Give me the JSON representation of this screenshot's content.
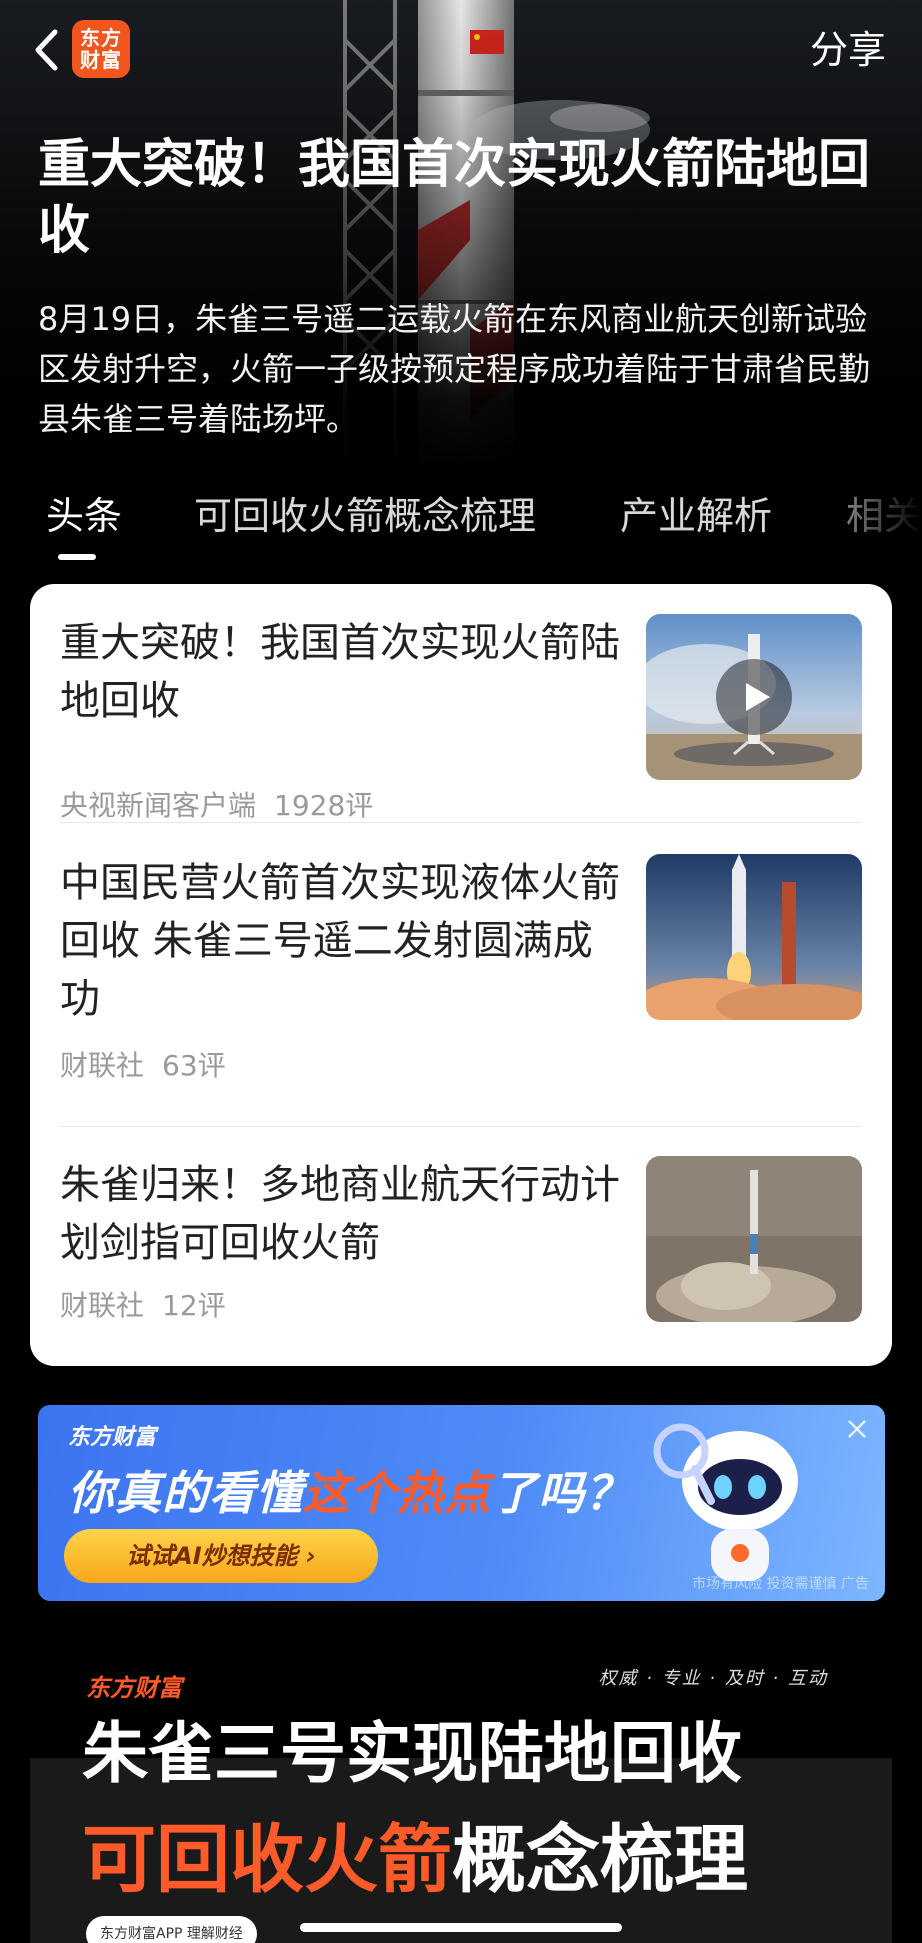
{
  "header": {
    "back_icon": "chevron-left-icon",
    "logo_text": "东方财富",
    "share_label": "分享"
  },
  "hero": {
    "title": "重大突破！我国首次实现火箭陆地回收",
    "summary": "8月19日，朱雀三号遥二运载火箭在东风商业航天创新试验区发射升空，火箭一子级按预定程序成功着陆于甘肃省民勤县朱雀三号着陆场坪。"
  },
  "tabs": [
    {
      "label": "头条",
      "active": true
    },
    {
      "label": "可回收火箭概念梳理",
      "active": false
    },
    {
      "label": "产业解析",
      "active": false
    },
    {
      "label": "相关",
      "active": false
    }
  ],
  "news": [
    {
      "title": "重大突破！我国首次实现火箭陆地回收",
      "source": "央视新闻客户端",
      "comments": "1928评",
      "has_video": true
    },
    {
      "title": "中国民营火箭首次实现液体火箭回收 朱雀三号遥二发射圆满成功",
      "source": "财联社",
      "comments": "63评",
      "has_video": false
    },
    {
      "title": "朱雀归来！多地商业航天行动计划剑指可回收火箭",
      "source": "财联社",
      "comments": "12评",
      "has_video": false
    }
  ],
  "ad": {
    "logo": "东方财富",
    "headline_a": "你真的看懂",
    "headline_b": "这个热点",
    "headline_c": "了吗？",
    "cta": "试试AI炒想技能 ›",
    "disclaimer": "市场有风险 投资需谨慎 广告"
  },
  "banner": {
    "logo": "东方财富",
    "tagline": "权威 · 专业 · 及时 · 互动",
    "line1": "朱雀三号实现陆地回收",
    "line2_highlight": "可回收火箭",
    "line2_rest": "概念梳理",
    "app_label": "东方财富APP  理解财经"
  },
  "colors": {
    "brand_orange": "#f0561d",
    "highlight": "#ff5a2a",
    "card_bg": "#ffffff",
    "ad_blue": "#3c74f0"
  }
}
